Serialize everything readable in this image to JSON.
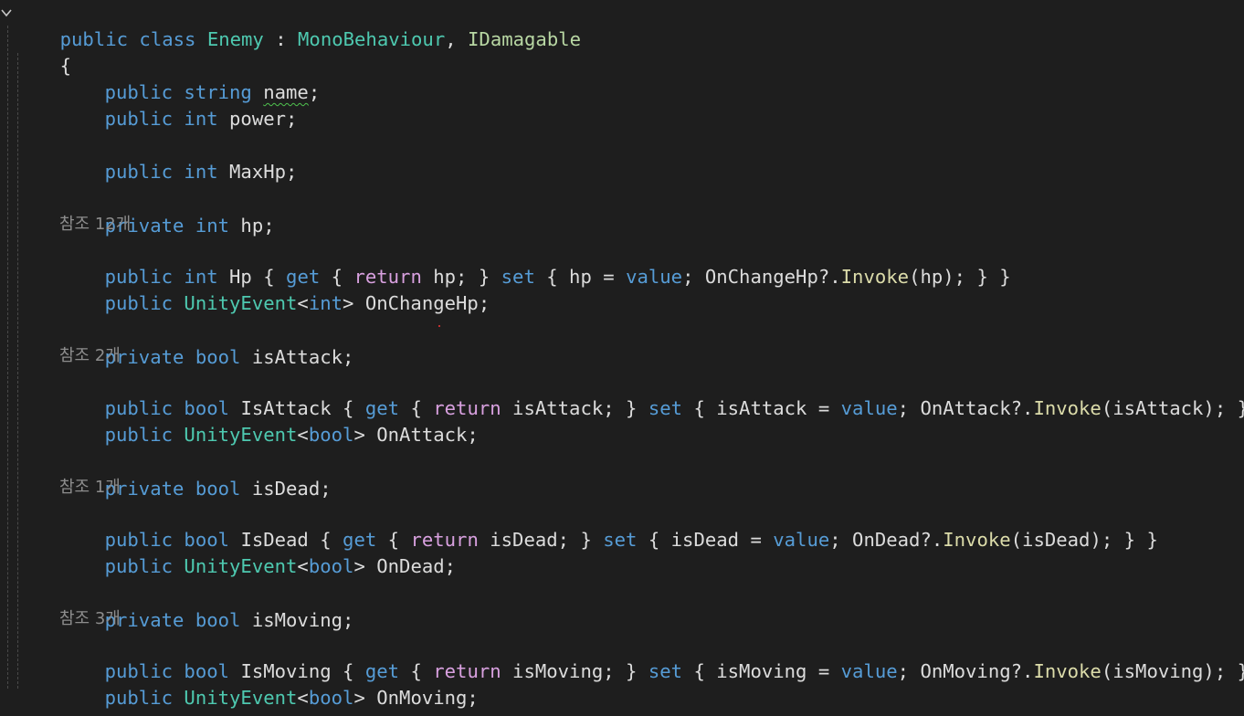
{
  "editor": {
    "class_declaration": {
      "access": "public",
      "keyword": "class",
      "class_name": "Enemy",
      "separator": " : ",
      "base_class": "MonoBehaviour",
      "comma": ", ",
      "interface_name": "IDamagable"
    },
    "open_brace": "{",
    "close_brace": "}",
    "fields": {
      "name_field": {
        "access": "public",
        "type": "string",
        "name": "name",
        "end": ";"
      },
      "power_field": {
        "access": "public",
        "type": "int",
        "name": "power;"
      },
      "maxhp_field": {
        "access": "public",
        "type": "int",
        "name": "MaxHp;"
      },
      "hp_field": {
        "access": "private",
        "type": "int",
        "name": "hp;"
      }
    },
    "hp_property": {
      "references": "참조 12개",
      "access": "public",
      "type": "int",
      "name": "Hp",
      "get_open": " { ",
      "get_kw": "get",
      "ret_open": " { ",
      "return_kw": "return",
      "ret_expr": " hp; } ",
      "set_kw": "set",
      "set_open": " { hp = ",
      "value_kw": "value",
      "mid": "; OnChangeHp?.",
      "invoke": "Invoke",
      "tail": "(hp); } }"
    },
    "hp_event": {
      "access": "public",
      "event_type": "UnityEvent",
      "lt": "<",
      "generic_type": "int",
      "gt": ">",
      "name": " OnChangeHp;"
    },
    "attack_field": {
      "access": "private",
      "type": "bool",
      "name": "isAttack;"
    },
    "attack_property": {
      "references": "참조 2개",
      "access": "public",
      "type": "bool",
      "name": "IsAttack",
      "get_open": " { ",
      "get_kw": "get",
      "ret_open": " { ",
      "return_kw": "return",
      "ret_expr": " isAttack; } ",
      "set_kw": "set",
      "set_open": " { isAttack = ",
      "value_kw": "value",
      "mid": "; OnAttack?.",
      "invoke": "Invoke",
      "tail": "(isAttack); } }"
    },
    "attack_event": {
      "access": "public",
      "event_type": "UnityEvent",
      "lt": "<",
      "generic_type": "bool",
      "gt": ">",
      "name": " OnAttack;"
    },
    "dead_field": {
      "access": "private",
      "type": "bool",
      "name": "isDead;"
    },
    "dead_property": {
      "references": "참조 1개",
      "access": "public",
      "type": "bool",
      "name": "IsDead",
      "get_open": " { ",
      "get_kw": "get",
      "ret_open": " { ",
      "return_kw": "return",
      "ret_expr": " isDead; } ",
      "set_kw": "set",
      "set_open": " { isDead = ",
      "value_kw": "value",
      "mid": "; OnDead?.",
      "invoke": "Invoke",
      "tail": "(isDead); } }"
    },
    "dead_event": {
      "access": "public",
      "event_type": "UnityEvent",
      "lt": "<",
      "generic_type": "bool",
      "gt": ">",
      "name": " OnDead;"
    },
    "moving_field": {
      "access": "private",
      "type": "bool",
      "name": "isMoving;"
    },
    "moving_property": {
      "references": "참조 3개",
      "access": "public",
      "type": "bool",
      "name": "IsMoving",
      "get_open": " { ",
      "get_kw": "get",
      "ret_open": " { ",
      "return_kw": "return",
      "ret_expr": " isMoving; } ",
      "set_kw": "set",
      "set_open": " { isMoving = ",
      "value_kw": "value",
      "mid": "; OnMoving?.",
      "invoke": "Invoke",
      "tail": "(isMoving); } }"
    },
    "moving_event": {
      "access": "public",
      "event_type": "UnityEvent",
      "lt": "<",
      "generic_type": "bool",
      "gt": ">",
      "name": " OnMoving;"
    }
  },
  "colors": {
    "background": "#1e1e1e",
    "keyword": "#569cd6",
    "control_keyword": "#d8a0df",
    "type": "#4ec9b0",
    "interface": "#b8d7a3",
    "method": "#dcdcaa",
    "text": "#dcdcdc",
    "codelens": "#8d8d8d",
    "squiggle": "#4ec24e"
  },
  "icons": {
    "fold": "chevron-down-icon"
  }
}
